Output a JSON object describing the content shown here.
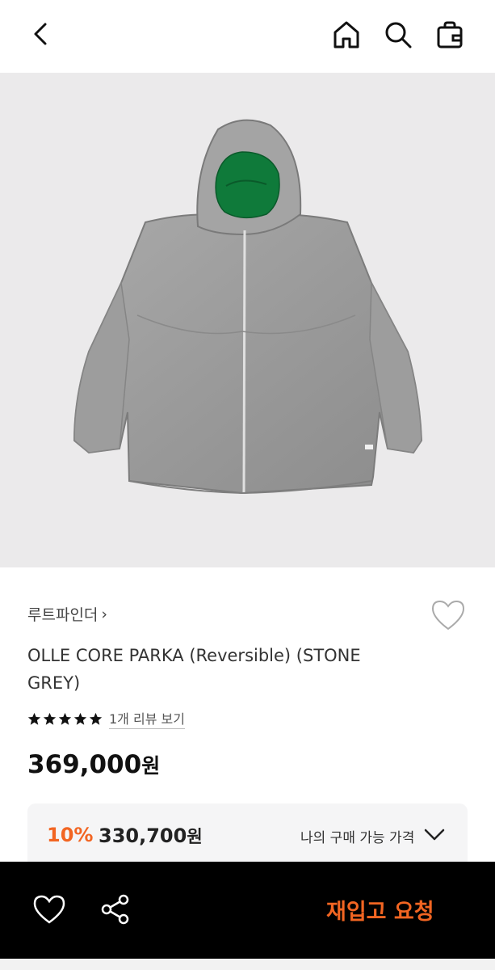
{
  "topbar": {
    "icons": [
      "back-arrow-icon",
      "home-icon",
      "search-icon",
      "shopping-bag-icon"
    ]
  },
  "product": {
    "image_alt": "reversible hooded parka, grey shell with green lining",
    "brand": "루트파인더",
    "brand_chevron": "›",
    "title": "OLLE CORE PARKA (Reversible) (STONE GREY)",
    "rating_stars": 5,
    "review_link": "1개 리뷰 보기",
    "price": "369,000",
    "currency": "원"
  },
  "discount": {
    "rate": "10%",
    "price": "330,700",
    "currency": "원",
    "my_price_label": "나의 구매 가능 가격"
  },
  "bottombar": {
    "restock_label": "재입고 요청"
  },
  "colors": {
    "accent": "#f26522",
    "bottom_bar_bg": "#000000",
    "hero_bg": "#ebeaeb",
    "discount_box_bg": "#f5f5f6"
  }
}
